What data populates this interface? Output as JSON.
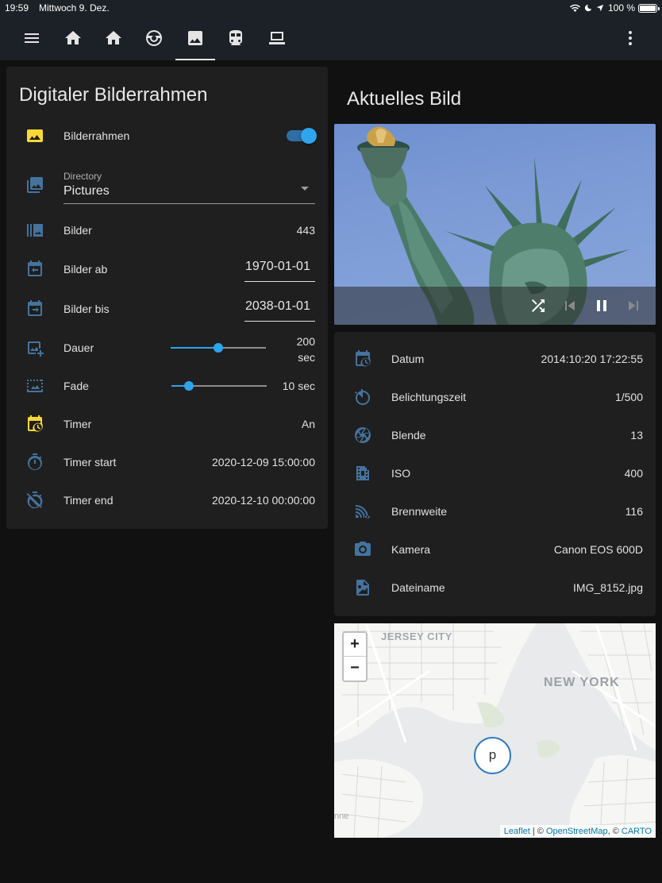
{
  "status_bar": {
    "time": "19:59",
    "date": "Mittwoch 9. Dez.",
    "battery": "100 %"
  },
  "toolbar": {
    "icons": [
      "menu-icon",
      "home-icon",
      "home-icon",
      "robot-icon",
      "image-icon",
      "train-icon",
      "laptop-icon",
      "more-vert-icon"
    ],
    "active_tab": "image-icon"
  },
  "left_card": {
    "title": "Digitaler Bilderrahmen",
    "bilderrahmen": {
      "label": "Bilderrahmen",
      "on": true
    },
    "directory": {
      "label": "Directory",
      "value": "Pictures"
    },
    "bilder": {
      "label": "Bilder",
      "value": "443"
    },
    "bilder_ab": {
      "label": "Bilder ab",
      "value": "1970-01-01"
    },
    "bilder_bis": {
      "label": "Bilder bis",
      "value": "2038-01-01"
    },
    "dauer": {
      "label": "Dauer",
      "value": "200",
      "unit": "sec",
      "level": 0.5
    },
    "fade": {
      "label": "Fade",
      "value": "10 sec",
      "level": 0.18
    },
    "timer": {
      "label": "Timer",
      "value": "An"
    },
    "timer_start": {
      "label": "Timer start",
      "value": "2020-12-09 15:00:00"
    },
    "timer_end": {
      "label": "Timer end",
      "value": "2020-12-10 00:00:00"
    }
  },
  "right": {
    "title": "Aktuelles Bild",
    "controls": [
      "shuffle-icon",
      "skip-previous-icon",
      "pause-icon",
      "skip-next-icon"
    ],
    "info": [
      {
        "icon": "calendar-clock-icon",
        "label": "Datum",
        "value": "2014:10:20 17:22:55"
      },
      {
        "icon": "timer-sand-icon",
        "label": "Belichtungszeit",
        "value": "1/500"
      },
      {
        "icon": "aperture-icon",
        "label": "Blende",
        "value": "13"
      },
      {
        "icon": "film-icon",
        "label": "ISO",
        "value": "400"
      },
      {
        "icon": "focal-length-icon",
        "label": "Brennweite",
        "value": "116"
      },
      {
        "icon": "camera-icon",
        "label": "Kamera",
        "value": "Canon EOS 600D"
      },
      {
        "icon": "file-image-icon",
        "label": "Dateiname",
        "value": "IMG_8152.jpg"
      }
    ]
  },
  "map": {
    "label_jersey_city": "JERSEY CITY",
    "label_new_york": "NEW YORK",
    "label_partial": "nne",
    "zoom_in": "+",
    "zoom_out": "−",
    "marker": "p",
    "attribution_leaflet": "Leaflet",
    "attribution_sep1": " | © ",
    "attribution_osm": "OpenStreetMap",
    "attribution_sep2": ", © ",
    "attribution_carto": "CARTO"
  }
}
